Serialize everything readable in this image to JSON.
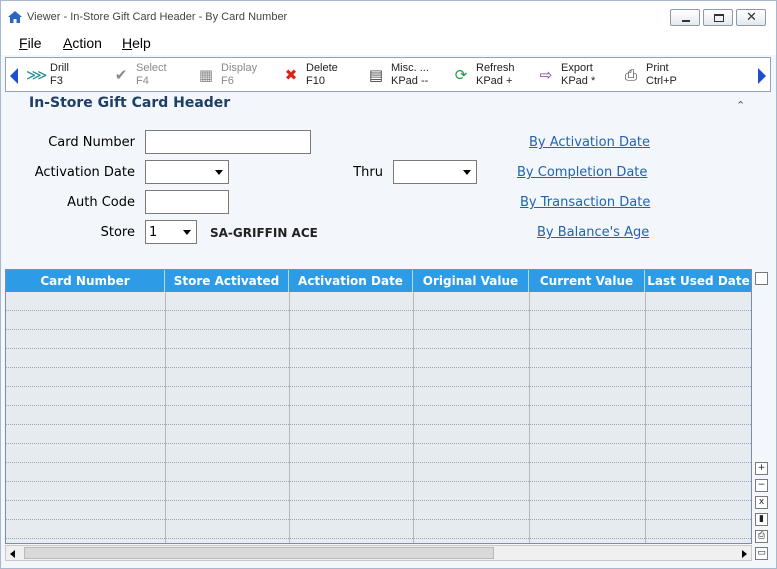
{
  "window": {
    "title": "Viewer - In-Store Gift Card Header - By Card Number",
    "close_glyph": "✕"
  },
  "menu": [
    {
      "label_first": "F",
      "label_rest": "ile"
    },
    {
      "label_first": "A",
      "label_rest": "ction"
    },
    {
      "label_first": "H",
      "label_rest": "elp"
    }
  ],
  "toolbar": {
    "buttons": [
      {
        "label": "Drill",
        "key": "F3",
        "icon": "drill-icon",
        "glyph": "⋙",
        "color": "#2a8f8f"
      },
      {
        "label": "Select",
        "key": "F4",
        "icon": "checkmark-icon",
        "glyph": "✔",
        "color": "#8a8a8a"
      },
      {
        "label": "Display",
        "key": "F6",
        "icon": "display-icon",
        "glyph": "▦",
        "color": "#8a8a8a"
      },
      {
        "label": "Delete",
        "key": "F10",
        "icon": "delete-x-icon",
        "glyph": "✖",
        "color": "#d8261b"
      },
      {
        "label": "Misc. ...",
        "key": "KPad --",
        "icon": "misc-document-icon",
        "glyph": "▤",
        "color": "#444444"
      },
      {
        "label": "Refresh",
        "key": "KPad +",
        "icon": "refresh-icon",
        "glyph": "⟳",
        "color": "#1f9a4d"
      },
      {
        "label": "Export",
        "key": "KPad *",
        "icon": "export-icon",
        "glyph": "⇨",
        "color": "#7a3f9a"
      },
      {
        "label": "Print",
        "key": "Ctrl+P",
        "icon": "printer-icon",
        "glyph": "⎙",
        "color": "#333333"
      }
    ]
  },
  "form": {
    "section_title": "In-Store Gift Card Header",
    "collapse_glyph": "⌃",
    "card_number_label": "Card Number",
    "card_number_value": "",
    "activation_date_label": "Activation Date",
    "activation_date_value": "",
    "thru_label": "Thru",
    "thru_value": "",
    "auth_code_label": "Auth Code",
    "auth_code_value": "",
    "store_label": "Store",
    "store_value": "1",
    "store_name": "SA-GRIFFIN ACE",
    "links": [
      "By Activation Date",
      "By Completion Date",
      "By Transaction Date",
      "By Balance's Age"
    ]
  },
  "grid": {
    "columns": [
      "Card Number",
      "Store Activated",
      "Activation Date",
      "Original Value",
      "Current Value",
      "Last Used Date"
    ],
    "rows": []
  },
  "side_tools": [
    {
      "name": "grid-add-icon",
      "glyph": "+"
    },
    {
      "name": "grid-remove-icon",
      "glyph": "−"
    },
    {
      "name": "grid-excel-icon",
      "glyph": "x"
    },
    {
      "name": "grid-chart-icon",
      "glyph": "▮"
    },
    {
      "name": "grid-print-icon",
      "glyph": "⎙"
    },
    {
      "name": "grid-folder-icon",
      "glyph": "▭"
    }
  ],
  "colors": {
    "header_blue": "#2e9be6",
    "title_navy": "#1e3f66",
    "link_blue": "#2064b0"
  }
}
